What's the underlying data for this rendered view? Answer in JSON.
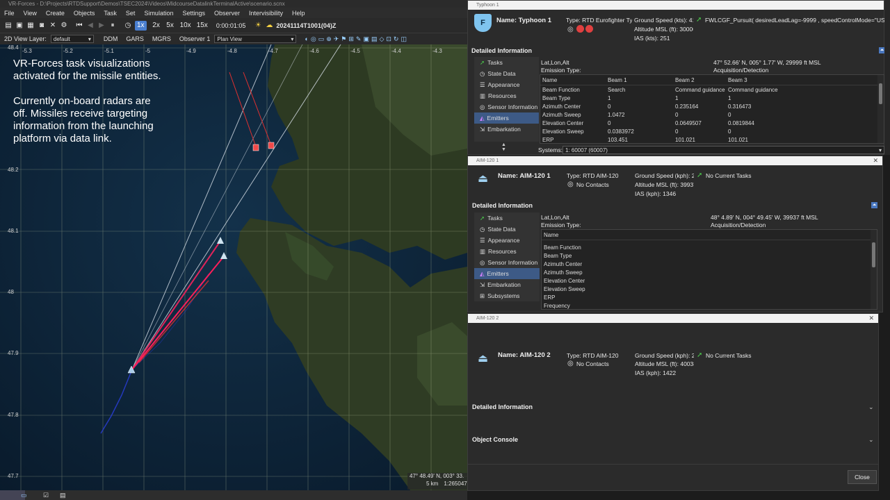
{
  "app": {
    "title": "VR-Forces - D:\\Projects\\RTDSupport\\Demos\\TSEC2024\\Videos\\MidcourseDatalinkTerminalActive\\scenario.scnx"
  },
  "menu": [
    "File",
    "View",
    "Create",
    "Objects",
    "Task",
    "Set",
    "Simulation",
    "Settings",
    "Observer",
    "Intervisibility",
    "Help"
  ],
  "toolbar": {
    "speeds": [
      "1x",
      "2x",
      "5x",
      "10x",
      "15x"
    ],
    "elapsed": "0:00:01:05",
    "datetime": "20241114T1001(04)Z"
  },
  "toolbar2": {
    "layer_label": "2D View Layer:",
    "layer_value": "default",
    "ddm": "DDM",
    "gars": "GARS",
    "mgrs": "MGRS",
    "observer": "Observer 1",
    "view": "Plan View"
  },
  "map": {
    "overlay_lines": [
      "VR-Forces task visualizations",
      "activated for the missile entities.",
      "",
      "Currently on-board radars are",
      "off. Missiles receive targeting",
      "information from the launching",
      "platform via data link."
    ],
    "lon_labels": [
      "-5.3",
      "-5.2",
      "-5.1",
      "-5",
      "-4.9",
      "-4.8",
      "-4.7",
      "-4.6",
      "-4.5",
      "-4.4",
      "-4.3"
    ],
    "lat_labels": [
      "48.4",
      "48.2",
      "48.1",
      "48",
      "47.9",
      "47.8",
      "47.7"
    ],
    "coord_readout": "47° 48.49' N, 003° 33.",
    "scale": "5 km",
    "scale_ratio": "1:265047"
  },
  "panel1": {
    "window_title": "Typhoon 1",
    "name": "Name: Typhoon 1",
    "type": "Type: RTD Eurofighter Typ",
    "ground_speed": "Ground Speed (kts): 41",
    "altitude": "Altitude MSL (ft): 30000",
    "ias": "IAS (kts): 251",
    "task": "FWLCGF_Pursuit( desiredLeadLag=-9999 , speedControlMode=\"USER_SP",
    "detailed": "Detailed Information",
    "latlonalt_label": "Lat,Lon,Alt",
    "latlonalt_value": "47° 52.66' N, 005° 1.77' W, 29999 ft MSL",
    "emission_label": "Emission Type:",
    "emission_value": "Acquisition/Detection",
    "side": [
      "Tasks",
      "State Data",
      "Appearance",
      "Resources",
      "Sensor Information",
      "Emitters",
      "Embarkation"
    ],
    "table_headers": [
      "Name",
      "Beam 1",
      "Beam 2",
      "Beam 3"
    ],
    "table_rows": [
      [
        "Beam Function",
        "Search",
        "Command guidance",
        "Command guidance"
      ],
      [
        "Beam Type",
        "1",
        "1",
        "1"
      ],
      [
        "Azimuth Center",
        "0",
        "0.235164",
        "0.316473"
      ],
      [
        "Azimuth Sweep",
        "1.0472",
        "0",
        "0"
      ],
      [
        "Elevation Center",
        "0",
        "0.0649507",
        "0.0819844"
      ],
      [
        "Elevation Sweep",
        "0.0383972",
        "0",
        "0"
      ],
      [
        "ERP",
        "103.451",
        "101.021",
        "101.021"
      ]
    ],
    "systems_label": "Systems:",
    "systems_value": "1: 60007 (60007)"
  },
  "panel2": {
    "window_title": "AIM-120 1",
    "name": "Name: AIM-120 1",
    "type": "Type: RTD AIM-120",
    "contacts": "No Contacts",
    "ground_speed": "Ground Speed (kph): 2",
    "altitude": "Altitude MSL (ft): 39937",
    "ias": "IAS (kph): 1346",
    "task": "No Current Tasks",
    "detailed": "Detailed Information",
    "latlonalt_label": "Lat,Lon,Alt",
    "latlonalt_value": "48° 4.89' N, 004° 49.45' W, 39937 ft MSL",
    "emission_label": "Emission Type:",
    "emission_value": "Acquisition/Detection",
    "side": [
      "Tasks",
      "State Data",
      "Appearance",
      "Resources",
      "Sensor Information",
      "Emitters",
      "Embarkation",
      "Subsystems"
    ],
    "table_header": "Name",
    "table_rows": [
      "Beam Function",
      "Beam Type",
      "Azimuth Center",
      "Azimuth Sweep",
      "Elevation Center",
      "Elevation Sweep",
      "ERP",
      "Frequency"
    ]
  },
  "panel3": {
    "window_title": "AIM-120 2",
    "name": "Name: AIM-120 2",
    "type": "Type: RTD AIM-120",
    "contacts": "No Contacts",
    "ground_speed": "Ground Speed (kph): 2",
    "altitude": "Altitude MSL (ft): 40038",
    "ias": "IAS (kph): 1422",
    "task": "No Current Tasks",
    "detailed": "Detailed Information",
    "console": "Object Console",
    "close": "Close"
  },
  "colors": {
    "accent": "#3d5a86",
    "missile_track": "#e0245a",
    "enemy_track": "#e03030"
  }
}
